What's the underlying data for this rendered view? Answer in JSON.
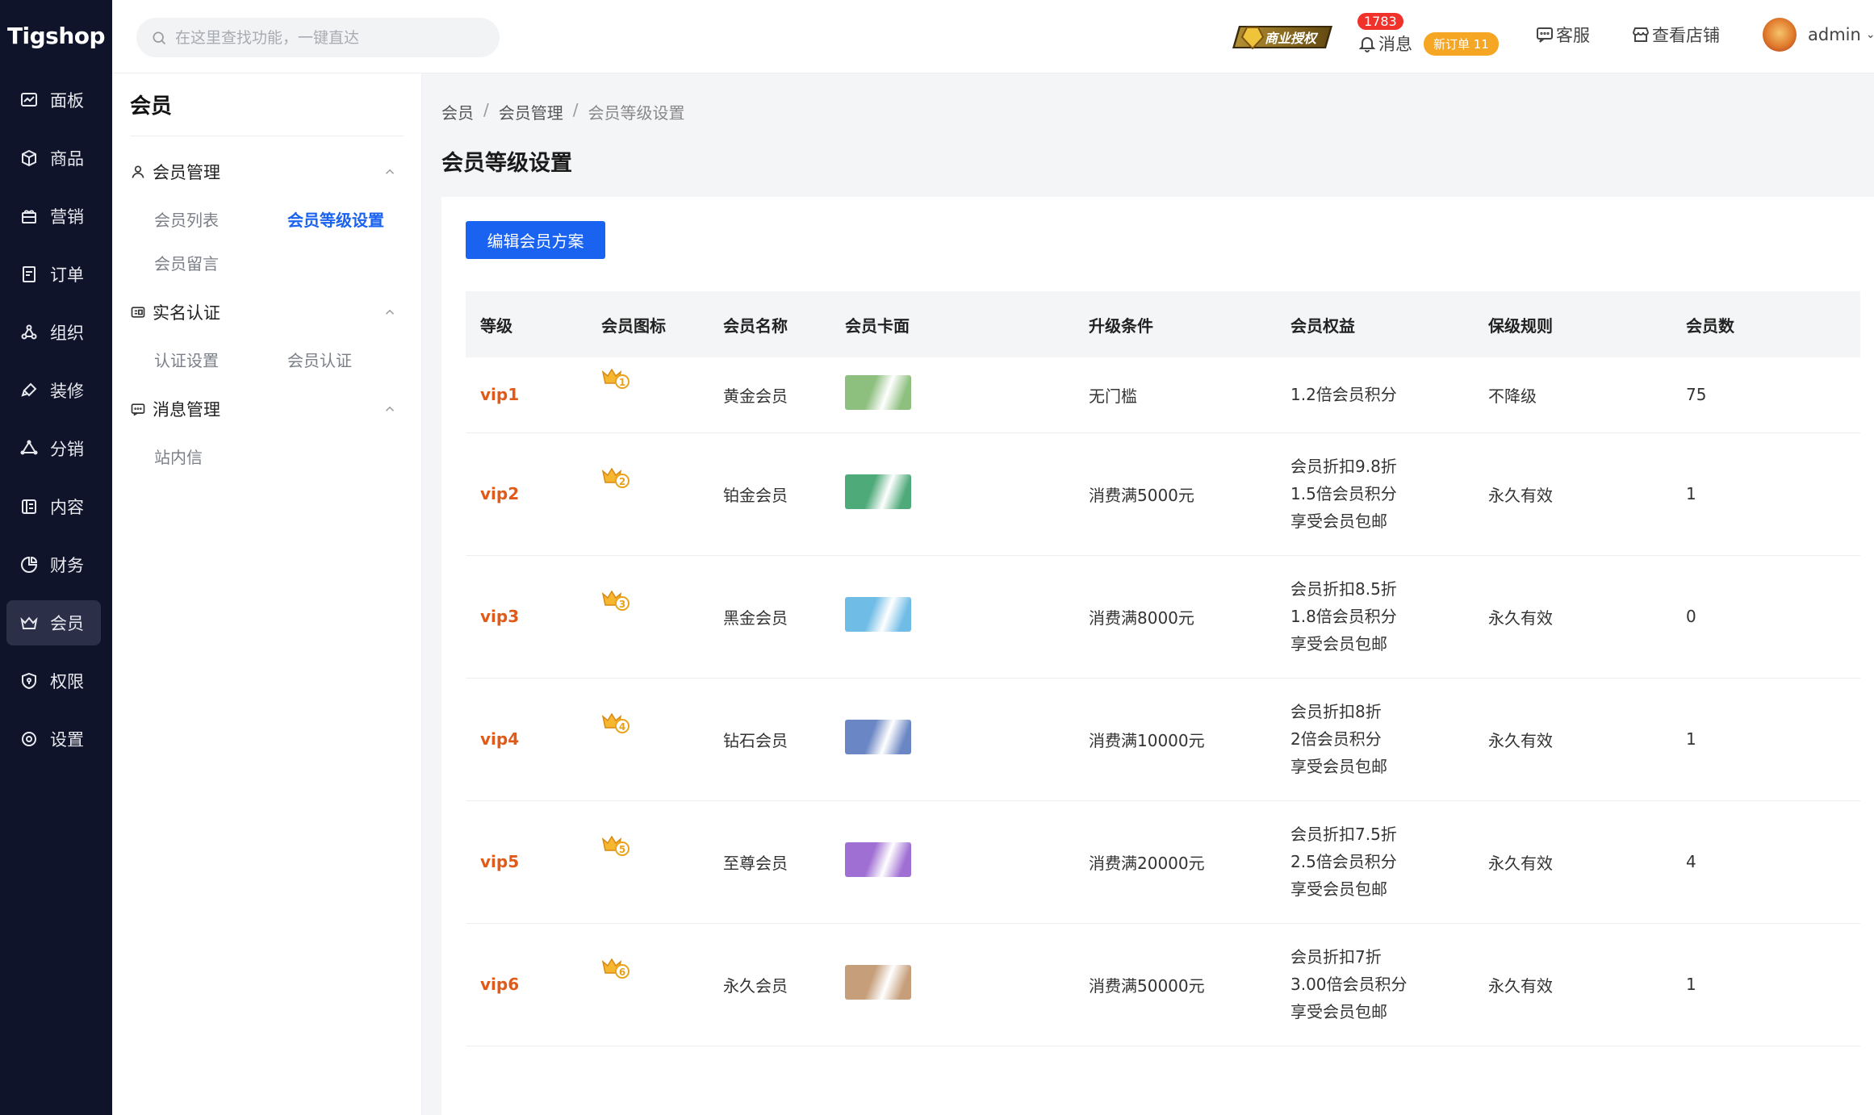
{
  "brand": "Tigshop",
  "search": {
    "placeholder": "在这里查找功能，一键直达"
  },
  "header": {
    "license_label": "商业授权",
    "message_count": "1783",
    "message_label": "消息",
    "new_order_label": "新订单 11",
    "service_label": "客服",
    "shop_label": "查看店铺",
    "username": "admin"
  },
  "main_nav": [
    {
      "label": "面板",
      "icon": "dashboard-icon"
    },
    {
      "label": "商品",
      "icon": "box-icon"
    },
    {
      "label": "营销",
      "icon": "gift-icon"
    },
    {
      "label": "订单",
      "icon": "order-icon"
    },
    {
      "label": "组织",
      "icon": "org-icon"
    },
    {
      "label": "装修",
      "icon": "brush-icon"
    },
    {
      "label": "分销",
      "icon": "share-icon"
    },
    {
      "label": "内容",
      "icon": "content-icon"
    },
    {
      "label": "财务",
      "icon": "pie-icon"
    },
    {
      "label": "会员",
      "icon": "crown-icon"
    },
    {
      "label": "权限",
      "icon": "shield-icon"
    },
    {
      "label": "设置",
      "icon": "gear-icon"
    }
  ],
  "sub_nav": {
    "title": "会员",
    "groups": [
      {
        "label": "会员管理",
        "items": [
          "会员列表",
          "会员等级设置",
          "会员留言"
        ]
      },
      {
        "label": "实名认证",
        "items": [
          "认证设置",
          "会员认证"
        ]
      },
      {
        "label": "消息管理",
        "items": [
          "站内信"
        ]
      }
    ]
  },
  "breadcrumb": [
    "会员",
    "会员管理",
    "会员等级设置"
  ],
  "page_title": "会员等级设置",
  "edit_button": "编辑会员方案",
  "table": {
    "headers": [
      "等级",
      "会员图标",
      "会员名称",
      "会员卡面",
      "升级条件",
      "会员权益",
      "保级规则",
      "会员数"
    ],
    "rows": [
      {
        "level": "vip1",
        "badge": "1",
        "name": "黄金会员",
        "card_color": "#8dbf7e",
        "condition": "无门槛",
        "rights": [
          "1.2倍会员积分"
        ],
        "rule": "不降级",
        "count": "75"
      },
      {
        "level": "vip2",
        "badge": "2",
        "name": "铂金会员",
        "card_color": "#4faa7a",
        "condition": "消费满5000元",
        "rights": [
          "会员折扣9.8折",
          "1.5倍会员积分",
          "享受会员包邮"
        ],
        "rule": "永久有效",
        "count": "1"
      },
      {
        "level": "vip3",
        "badge": "3",
        "name": "黑金会员",
        "card_color": "#6fbce6",
        "condition": "消费满8000元",
        "rights": [
          "会员折扣8.5折",
          "1.8倍会员积分",
          "享受会员包邮"
        ],
        "rule": "永久有效",
        "count": "0"
      },
      {
        "level": "vip4",
        "badge": "4",
        "name": "钻石会员",
        "card_color": "#6a86c4",
        "condition": "消费满10000元",
        "rights": [
          "会员折扣8折",
          "2倍会员积分",
          "享受会员包邮"
        ],
        "rule": "永久有效",
        "count": "1"
      },
      {
        "level": "vip5",
        "badge": "5",
        "name": "至尊会员",
        "card_color": "#a06fd4",
        "condition": "消费满20000元",
        "rights": [
          "会员折扣7.5折",
          "2.5倍会员积分",
          "享受会员包邮"
        ],
        "rule": "永久有效",
        "count": "4"
      },
      {
        "level": "vip6",
        "badge": "6",
        "name": "永久会员",
        "card_color": "#c69e7a",
        "condition": "消费满50000元",
        "rights": [
          "会员折扣7折",
          "3.00倍会员积分",
          "享受会员包邮"
        ],
        "rule": "永久有效",
        "count": "1"
      }
    ]
  },
  "colors": {
    "primary": "#1a62f0",
    "level_text": "#e05a1a",
    "sidebar_bg": "#10142a"
  }
}
